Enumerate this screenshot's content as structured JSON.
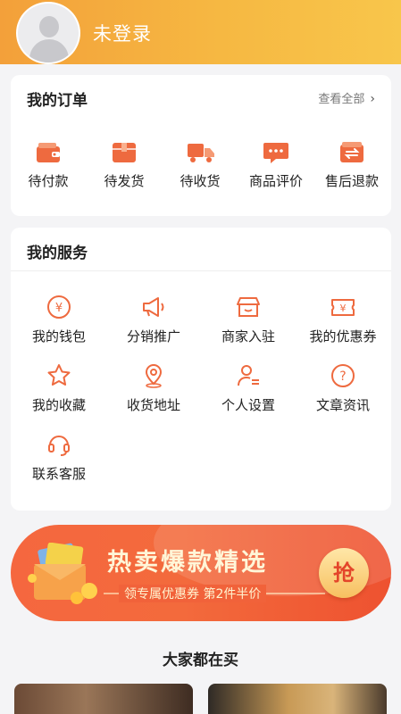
{
  "header": {
    "login_text": "未登录",
    "avatar_icon": "user-avatar-icon"
  },
  "orders": {
    "title": "我的订单",
    "view_all": "查看全部",
    "view_all_icon": "chevron-right-icon",
    "items": [
      {
        "label": "待付款",
        "icon": "wallet-icon"
      },
      {
        "label": "待发货",
        "icon": "package-icon"
      },
      {
        "label": "待收货",
        "icon": "truck-icon"
      },
      {
        "label": "商品评价",
        "icon": "comment-icon"
      },
      {
        "label": "售后退款",
        "icon": "refund-icon"
      }
    ]
  },
  "services": {
    "title": "我的服务",
    "items": [
      {
        "label": "我的钱包",
        "icon": "yen-coin-icon"
      },
      {
        "label": "分销推广",
        "icon": "megaphone-icon"
      },
      {
        "label": "商家入驻",
        "icon": "store-icon"
      },
      {
        "label": "我的优惠券",
        "icon": "coupon-icon"
      },
      {
        "label": "我的收藏",
        "icon": "star-icon"
      },
      {
        "label": "收货地址",
        "icon": "location-pin-icon"
      },
      {
        "label": "个人设置",
        "icon": "user-settings-icon"
      },
      {
        "label": "文章资讯",
        "icon": "question-icon"
      },
      {
        "label": "联系客服",
        "icon": "headset-icon"
      }
    ]
  },
  "banner": {
    "title": "热卖爆款精选",
    "subtitle": "领专属优惠券 第2件半价",
    "button": "抢"
  },
  "section": {
    "title": "大家都在买"
  },
  "colors": {
    "accent": "#f06a3c",
    "header_start": "#f3a03a",
    "header_end": "#f8c64b",
    "icon": "#ee6a3f"
  }
}
